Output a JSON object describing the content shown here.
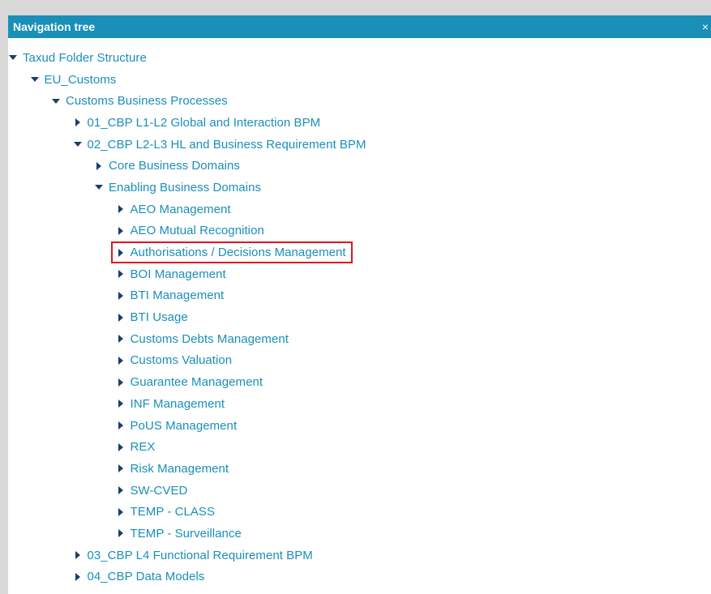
{
  "panel": {
    "title": "Navigation tree",
    "close_glyph": "×"
  },
  "tree": [
    {
      "label": "Taxud Folder Structure",
      "level": 0,
      "state": "expanded"
    },
    {
      "label": "EU_Customs",
      "level": 1,
      "state": "expanded"
    },
    {
      "label": "Customs Business Processes",
      "level": 2,
      "state": "expanded"
    },
    {
      "label": "01_CBP L1-L2 Global and Interaction BPM",
      "level": 3,
      "state": "collapsed"
    },
    {
      "label": "02_CBP L2-L3 HL and Business Requirement BPM",
      "level": 3,
      "state": "expanded"
    },
    {
      "label": "Core Business Domains",
      "level": 4,
      "state": "collapsed"
    },
    {
      "label": "Enabling Business Domains",
      "level": 4,
      "state": "expanded"
    },
    {
      "label": "AEO Management",
      "level": 5,
      "state": "collapsed"
    },
    {
      "label": "AEO Mutual Recognition",
      "level": 5,
      "state": "collapsed"
    },
    {
      "label": "Authorisations / Decisions Management",
      "level": 5,
      "state": "collapsed",
      "highlighted": true
    },
    {
      "label": "BOI Management",
      "level": 5,
      "state": "collapsed"
    },
    {
      "label": "BTI Management",
      "level": 5,
      "state": "collapsed"
    },
    {
      "label": "BTI Usage",
      "level": 5,
      "state": "collapsed"
    },
    {
      "label": "Customs Debts Management",
      "level": 5,
      "state": "collapsed"
    },
    {
      "label": "Customs Valuation",
      "level": 5,
      "state": "collapsed"
    },
    {
      "label": "Guarantee Management",
      "level": 5,
      "state": "collapsed"
    },
    {
      "label": "INF Management",
      "level": 5,
      "state": "collapsed"
    },
    {
      "label": "PoUS Management",
      "level": 5,
      "state": "collapsed"
    },
    {
      "label": "REX",
      "level": 5,
      "state": "collapsed"
    },
    {
      "label": "Risk Management",
      "level": 5,
      "state": "collapsed"
    },
    {
      "label": "SW-CVED",
      "level": 5,
      "state": "collapsed"
    },
    {
      "label": "TEMP - CLASS",
      "level": 5,
      "state": "collapsed"
    },
    {
      "label": "TEMP - Surveillance",
      "level": 5,
      "state": "collapsed"
    },
    {
      "label": "03_CBP L4 Functional Requirement BPM",
      "level": 3,
      "state": "collapsed"
    },
    {
      "label": "04_CBP Data Models",
      "level": 3,
      "state": "collapsed"
    }
  ],
  "colors": {
    "header": "#1a8fb8",
    "link": "#1a8fb8",
    "arrow": "#1a3e6e",
    "highlight_border": "#e0151e"
  }
}
